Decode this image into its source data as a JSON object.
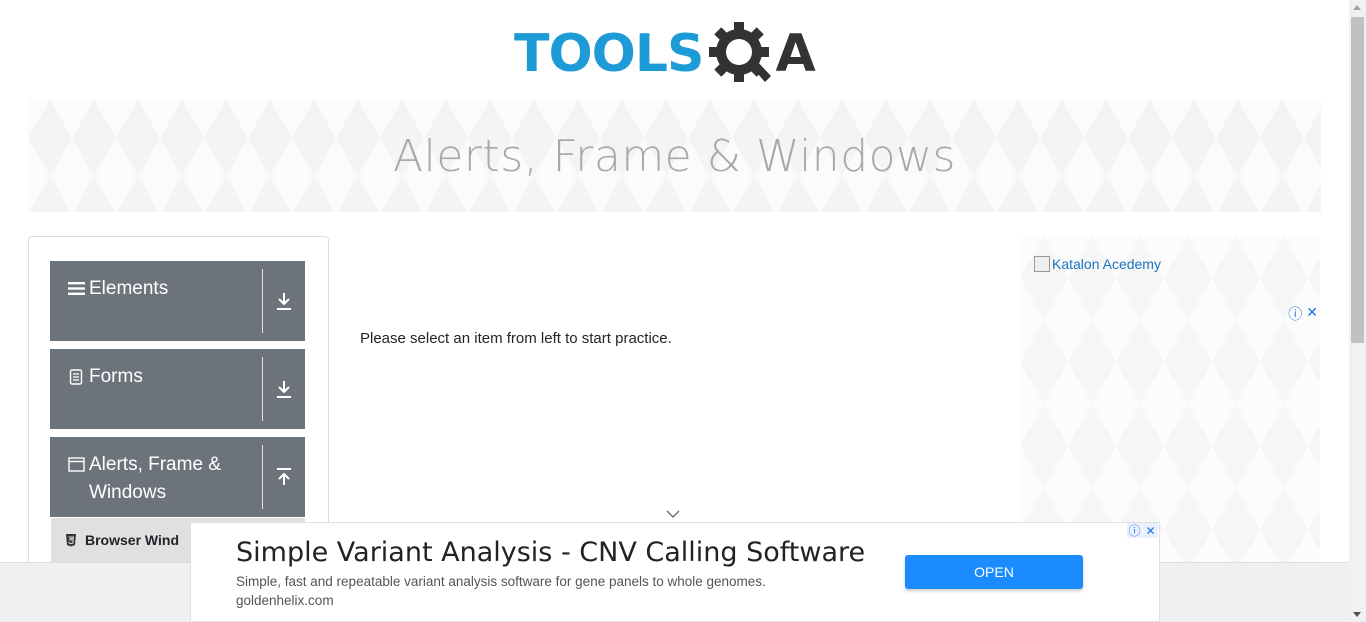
{
  "logo": {
    "part1": "TOOLS",
    "part2": "A",
    "colors": {
      "tools": "#1d9bd7",
      "qa": "#333333"
    }
  },
  "banner": {
    "title": "Alerts, Frame & Windows"
  },
  "sidebar": {
    "groups": [
      {
        "label": "Elements",
        "icon": "hamburger-icon",
        "toggle": "download-arrow-icon"
      },
      {
        "label": "Forms",
        "icon": "document-icon",
        "toggle": "download-arrow-icon"
      },
      {
        "label": "Alerts, Frame & Windows",
        "icon": "window-icon",
        "toggle": "upload-arrow-icon"
      }
    ],
    "subitem": {
      "label": "Browser Wind",
      "icon": "html5-icon"
    },
    "group_color": "#6c737b"
  },
  "main": {
    "message": "Please select an item from left to start practice."
  },
  "right_ad": {
    "alt_text": "Katalon Acedemy"
  },
  "bottom_ad": {
    "title": "Simple Variant Analysis - CNV Calling Software",
    "description": "Simple, fast and repeatable variant analysis software for gene panels to whole genomes.",
    "url": "goldenhelix.com",
    "button": "OPEN",
    "button_color": "#1a8cff"
  }
}
